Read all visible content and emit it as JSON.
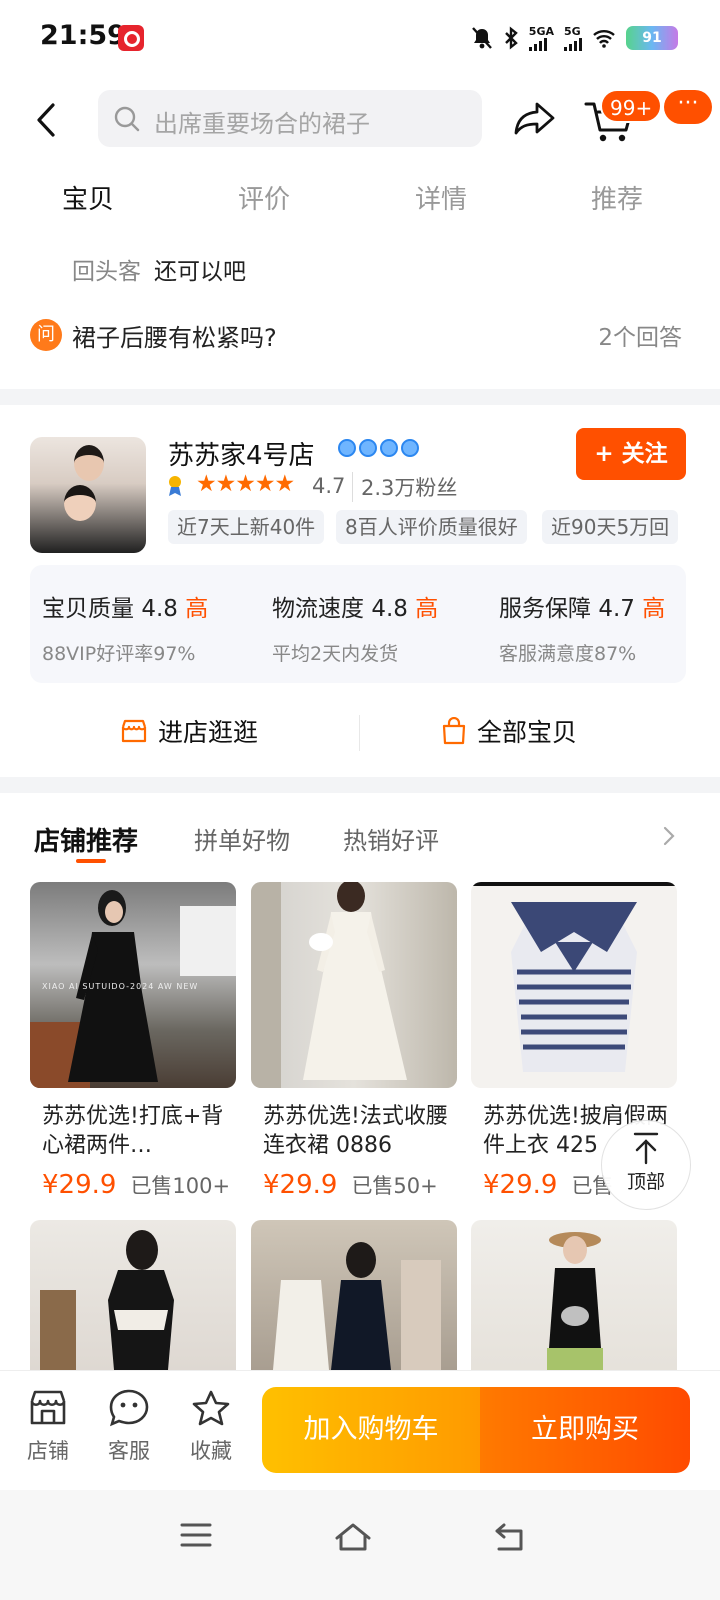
{
  "status_bar": {
    "time": "21:59",
    "network_1": "5GA",
    "network_2": "5G",
    "battery": "91",
    "icons": [
      "app-notification-icon",
      "mute-icon",
      "bluetooth-icon",
      "signal-icon",
      "wifi-icon",
      "battery-icon"
    ]
  },
  "header": {
    "search_placeholder": "出席重要场合的裙子",
    "cart_badge": "99+",
    "more_label": "···"
  },
  "tabs": [
    "宝贝",
    "评价",
    "详情",
    "推荐"
  ],
  "review": {
    "label": "回头客",
    "text": "还可以吧"
  },
  "qa": {
    "icon_text": "问",
    "question": "裙子后腰有松紧吗?",
    "answers": "2个回答"
  },
  "shop": {
    "name": "苏苏家4号店",
    "rating": "4.7",
    "fans": "2.3万粉丝",
    "follow_label": "+ 关注",
    "tags": [
      "近7天上新40件",
      "8百人评价质量很好",
      "近90天5万回"
    ],
    "scores": [
      {
        "title": "宝贝质量",
        "value": "4.8",
        "level": "高",
        "sub": "88VIP好评率97%"
      },
      {
        "title": "物流速度",
        "value": "4.8",
        "level": "高",
        "sub": "平均2天内发货"
      },
      {
        "title": "服务保障",
        "value": "4.7",
        "level": "高",
        "sub": "客服满意度87%"
      }
    ],
    "enter_label": "进店逛逛",
    "all_label": "全部宝贝"
  },
  "recommend": {
    "tabs": [
      "店铺推荐",
      "拼单好物",
      "热销好评"
    ],
    "products": [
      {
        "title": "苏苏优选!打底+背心裙两件…",
        "price": "¥29.9",
        "sold": "已售100+",
        "watermark": "XIAO AI SUTUIDO-2024 AW NEW"
      },
      {
        "title": "苏苏优选!法式收腰连衣裙 0886",
        "price": "¥29.9",
        "sold": "已售50+"
      },
      {
        "title": "苏苏优选!披肩假两件上衣 425",
        "price": "¥29.9",
        "sold": "已售"
      },
      {
        "title": "",
        "price": "",
        "sold": ""
      },
      {
        "title": "",
        "price": "",
        "sold": ""
      },
      {
        "title": "",
        "price": "",
        "sold": ""
      }
    ]
  },
  "back_to_top": "顶部",
  "bottom_bar": {
    "store": "店铺",
    "service": "客服",
    "favorite": "收藏",
    "add_cart": "加入购物车",
    "buy_now": "立即购买"
  },
  "colors": {
    "accent": "#ff5000",
    "cart_button": "#ffb000",
    "buy_button": "#ff5a00"
  }
}
